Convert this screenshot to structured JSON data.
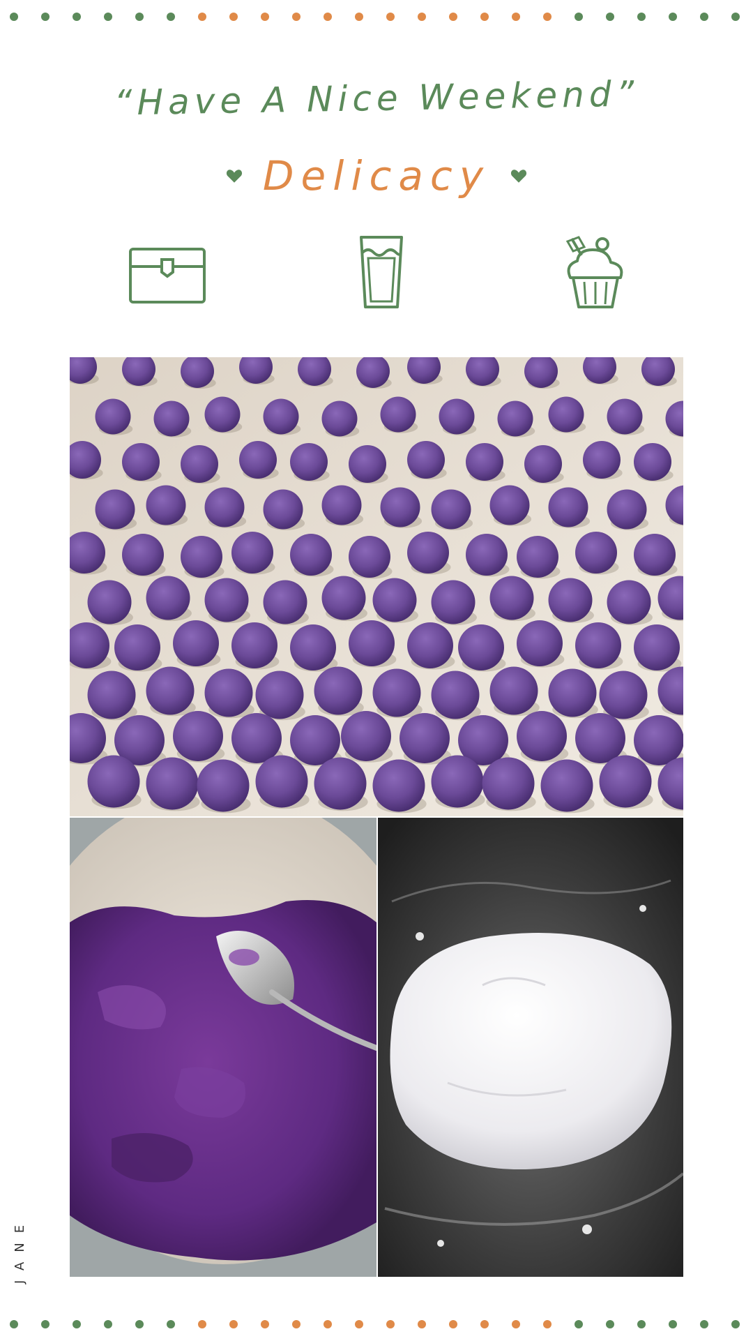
{
  "header": {
    "tagline": "“Have A Nice Weekend”",
    "subtitle": "Delicacy"
  },
  "icons": [
    {
      "name": "briefcase-icon"
    },
    {
      "name": "drink-glass-icon"
    },
    {
      "name": "cupcake-icon"
    }
  ],
  "side_label": "JANE",
  "photos": [
    {
      "name": "photo-purple-balls"
    },
    {
      "name": "photo-mashed-purple-sweet-potato"
    },
    {
      "name": "photo-white-dough"
    }
  ],
  "colors": {
    "green": "#5b8a5a",
    "orange": "#e08a48",
    "purple": "#6b4a98",
    "tray": "#ebe2d6"
  }
}
